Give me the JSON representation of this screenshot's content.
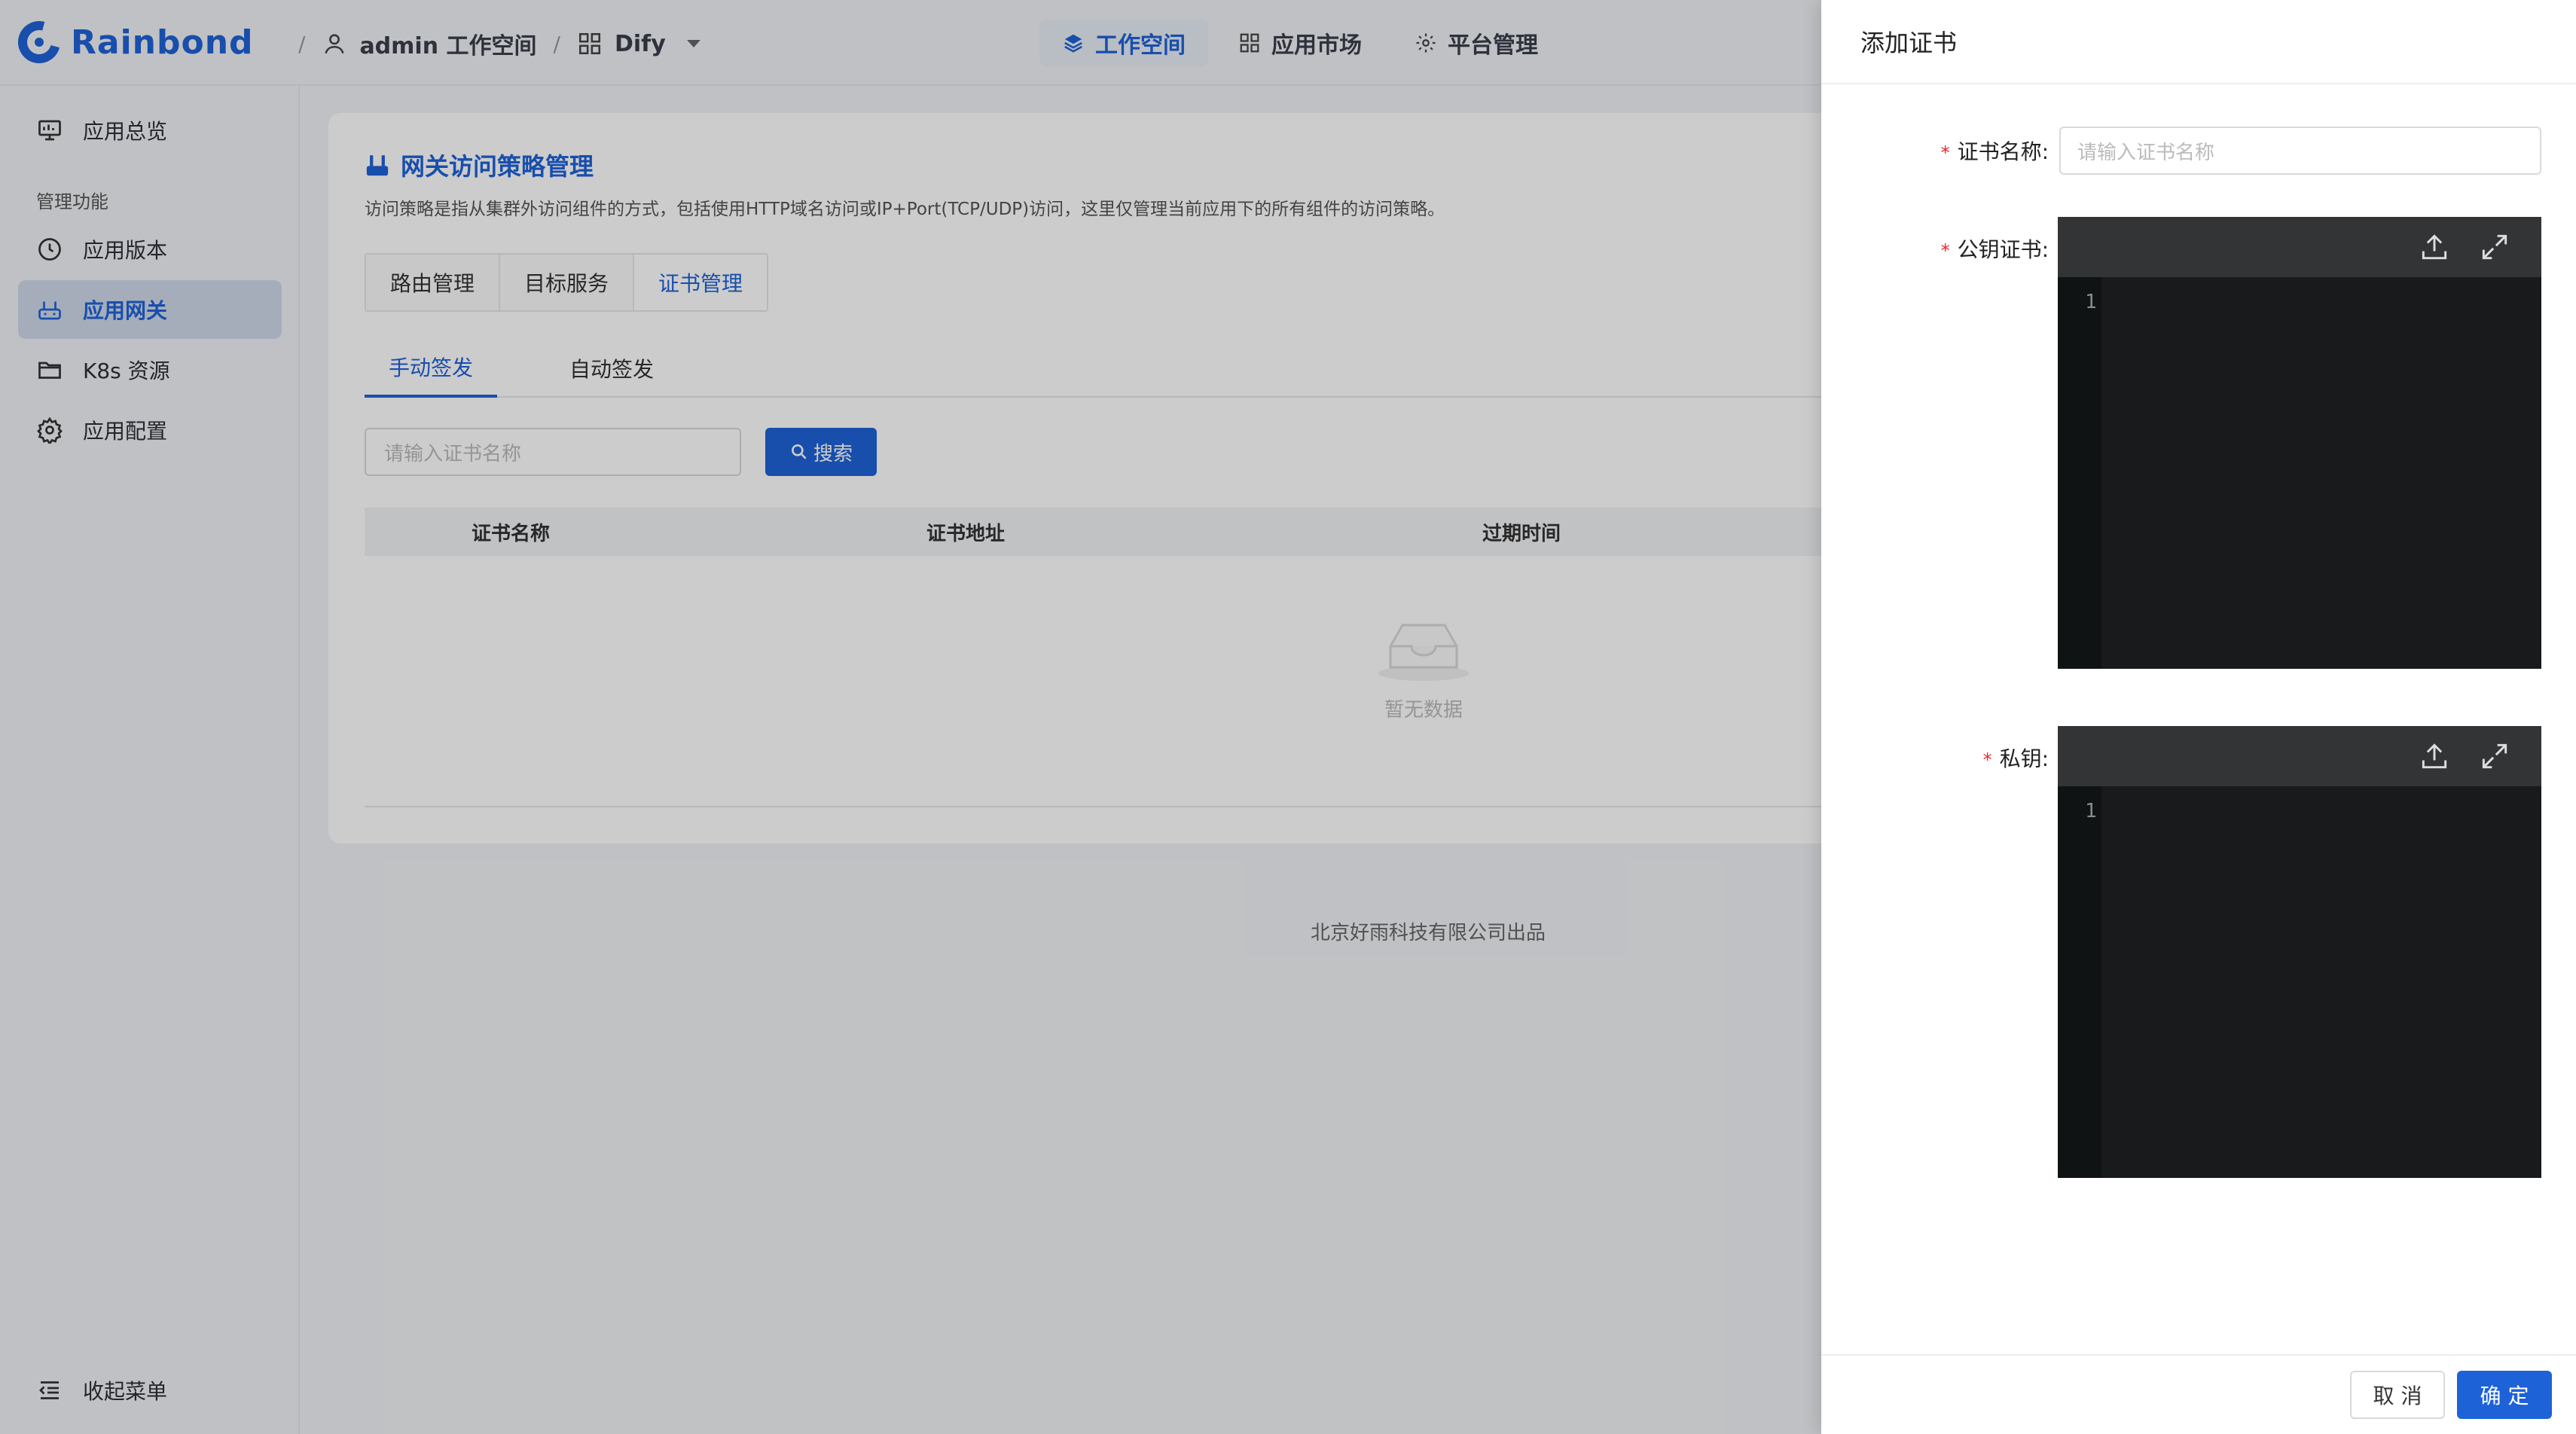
{
  "brand": {
    "name": "Rainbond",
    "color": "#1e62d8"
  },
  "breadcrumb": {
    "separator": "/",
    "workspace": "admin 工作空间",
    "app": "Dify"
  },
  "topnav": {
    "items": [
      {
        "label": "工作空间",
        "icon": "layers-icon",
        "active": true
      },
      {
        "label": "应用市场",
        "icon": "grid-icon",
        "active": false
      },
      {
        "label": "平台管理",
        "icon": "gear-icon",
        "active": false
      }
    ]
  },
  "sidebar": {
    "overview": "应用总览",
    "group_label": "管理功能",
    "items": [
      {
        "label": "应用版本",
        "icon": "clock-icon",
        "active": false
      },
      {
        "label": "应用网关",
        "icon": "gateway-icon",
        "active": true
      },
      {
        "label": "K8s 资源",
        "icon": "folder-icon",
        "active": false
      },
      {
        "label": "应用配置",
        "icon": "gear-icon",
        "active": false
      }
    ],
    "collapse": "收起菜单"
  },
  "main": {
    "title": "网关访问策略管理",
    "description": "访问策略是指从集群外访问组件的方式，包括使用HTTP域名访问或IP+Port(TCP/UDP)访问，这里仅管理当前应用下的所有组件的访问策略。",
    "tabs": [
      "路由管理",
      "目标服务",
      "证书管理"
    ],
    "active_tab": 2,
    "subtabs": [
      "手动签发",
      "自动签发"
    ],
    "search": {
      "placeholder": "请输入证书名称",
      "button": "搜索"
    },
    "table": {
      "columns": [
        "证书名称",
        "证书地址",
        "过期时间"
      ],
      "empty_text": "暂无数据"
    },
    "footer": "北京好雨科技有限公司出品"
  },
  "drawer": {
    "title": "添加证书",
    "fields": {
      "name_label": "证书名称:",
      "name_placeholder": "请输入证书名称",
      "public_label": "公钥证书:",
      "private_label": "私钥:"
    },
    "editor_line": "1",
    "cancel": "取 消",
    "confirm": "确 定"
  }
}
